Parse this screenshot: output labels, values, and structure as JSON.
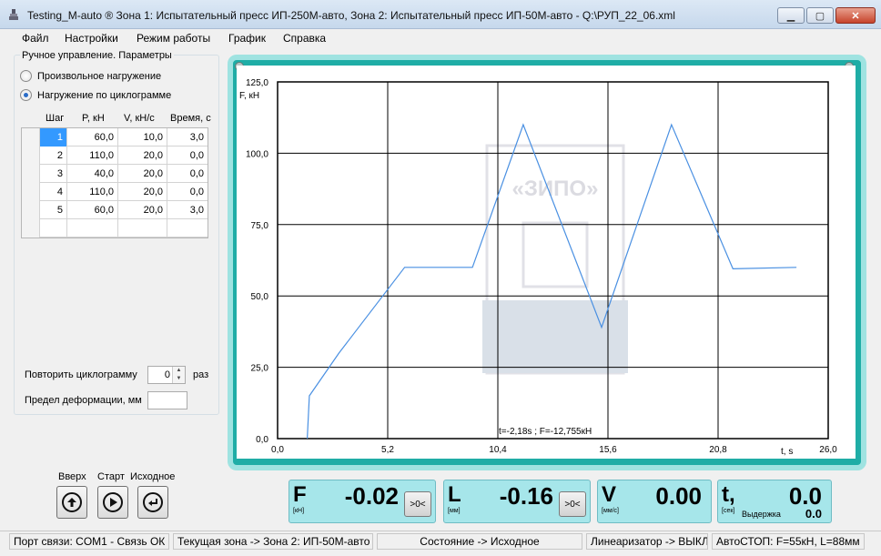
{
  "window": {
    "title": "Testing_M-auto ® Зона 1: Испытательный пресс ИП-250М-авто, Зона 2: Испытательный пресс ИП-50М-авто - Q:\\РУП_22_06.xml",
    "minimize_glyph": "▁",
    "maximize_glyph": "▢",
    "close_glyph": "✕"
  },
  "menu": [
    "Файл",
    "Настройки",
    "Режим работы",
    "График",
    "Справка"
  ],
  "params": {
    "group_title": "Ручное управление. Параметры",
    "radio_free": "Произвольное нагружение",
    "radio_cyclogram": "Нагружение по циклограмме",
    "columns": [
      "Шаг",
      "P, кН",
      "V, кН/с",
      "Время, с"
    ],
    "rows": [
      {
        "step": "1",
        "p": "60,0",
        "v": "10,0",
        "t": "3,0"
      },
      {
        "step": "2",
        "p": "110,0",
        "v": "20,0",
        "t": "0,0"
      },
      {
        "step": "3",
        "p": "40,0",
        "v": "20,0",
        "t": "0,0"
      },
      {
        "step": "4",
        "p": "110,0",
        "v": "20,0",
        "t": "0,0"
      },
      {
        "step": "5",
        "p": "60,0",
        "v": "20,0",
        "t": "3,0"
      }
    ],
    "repeat_label": "Повторить циклограмму",
    "repeat_value": "0",
    "repeat_unit": "раз",
    "deform_label": "Предел деформации, мм",
    "deform_value": ""
  },
  "controls": {
    "up_label": "Вверх",
    "start_label": "Старт",
    "home_label": "Исходное"
  },
  "chart": {
    "watermark": "«ЗИПО»",
    "cursor_readout": "t=-2,18s ; F=-12,755кН"
  },
  "chart_data": {
    "type": "line",
    "ylabel": "F, кН",
    "xlabel": "t, s",
    "xlim": [
      0,
      26
    ],
    "ylim": [
      0,
      125
    ],
    "xticks": [
      "0,0",
      "5,2",
      "10,4",
      "15,6",
      "20,8",
      "26,0"
    ],
    "yticks": [
      "0,0",
      "25,0",
      "50,0",
      "75,0",
      "100,0",
      "125,0"
    ],
    "grid": true,
    "series": [
      {
        "x": [
          1.4,
          1.5,
          2.9,
          6.0,
          9.2,
          11.6,
          15.3,
          18.6,
          21.5,
          24.5
        ],
        "y": [
          0,
          15,
          30,
          60,
          60,
          110,
          39,
          110,
          59.5,
          60
        ]
      }
    ]
  },
  "readouts": {
    "f": {
      "letter": "F",
      "unit": "[кН]",
      "value": "-0.02",
      "zero": ">0<"
    },
    "l": {
      "letter": "L",
      "unit": "[мм]",
      "value": "-0.16",
      "zero": ">0<"
    },
    "v": {
      "letter": "V",
      "unit": "[мм/с]",
      "value": "0.00"
    },
    "t": {
      "letter": "t,",
      "unit": "[сек]",
      "value": "0.0",
      "sub_label": "Выдержка",
      "sub_value": "0.0"
    }
  },
  "status": {
    "port": "Порт связи: COM1 - Связь ОК",
    "zone": "Текущая зона -> Зона 2: ИП-50М-авто",
    "state": "Состояние -> Исходное",
    "linearizer": "Линеаризатор -> ВЫКЛ",
    "autostop": "АвтоСТОП: F=55кН, L=88мм"
  },
  "colors": {
    "chart_frame": "#1fada6",
    "series": "#4a90e2",
    "readout_bg": "#a6e6ea"
  }
}
